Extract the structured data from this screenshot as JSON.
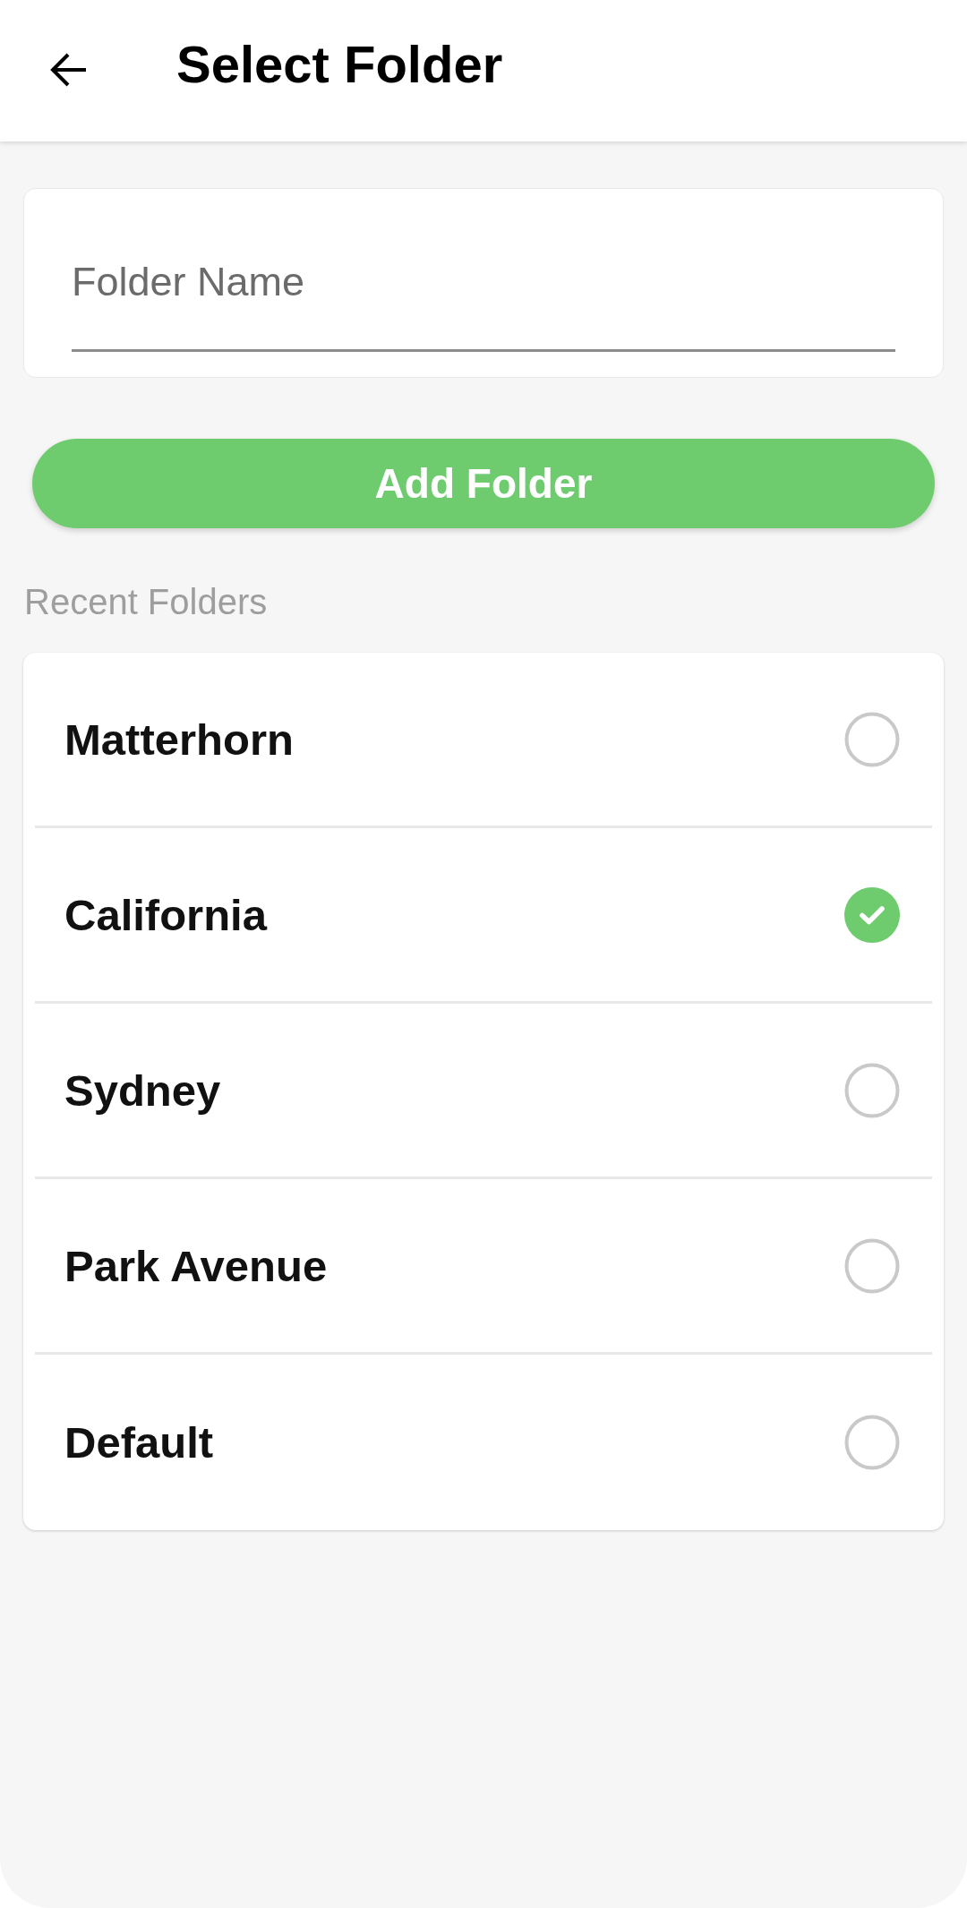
{
  "header": {
    "title": "Select Folder"
  },
  "folder_name_field": {
    "placeholder": "Folder Name"
  },
  "add_button": {
    "label": "Add Folder"
  },
  "recent_section": {
    "title": "Recent Folders"
  },
  "folders": [
    {
      "name": "Matterhorn",
      "selected": false
    },
    {
      "name": "California",
      "selected": true
    },
    {
      "name": "Sydney",
      "selected": false
    },
    {
      "name": "Park Avenue",
      "selected": false
    },
    {
      "name": "Default",
      "selected": false
    }
  ]
}
